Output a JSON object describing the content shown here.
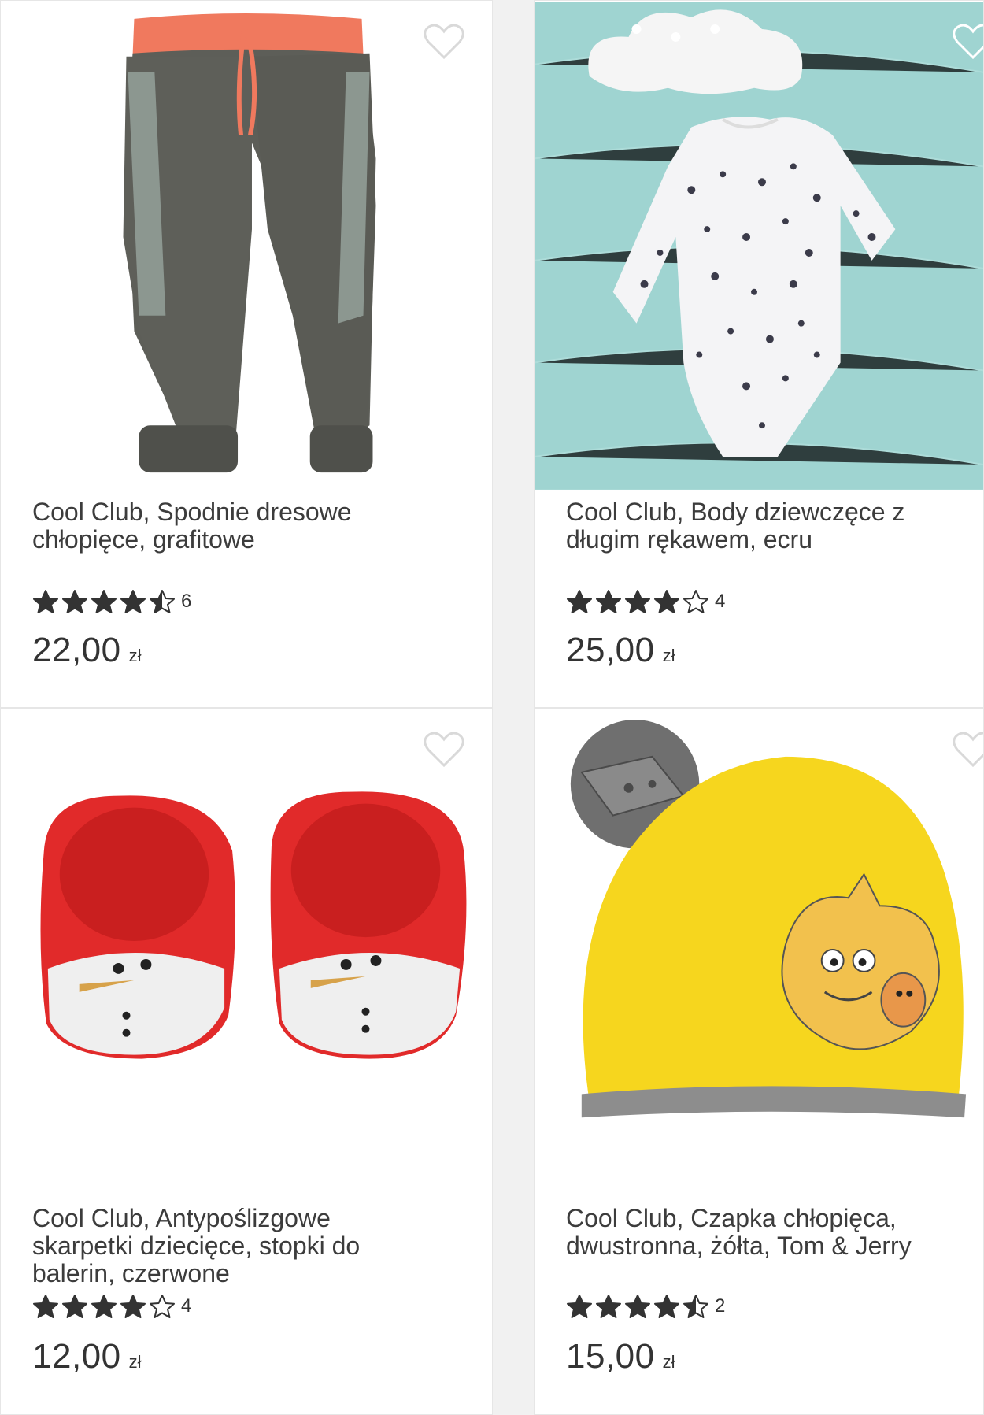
{
  "currency_symbol": "zł",
  "products": [
    {
      "title": "Cool Club, Spodnie dresowe chłopięce, grafitowe",
      "rating": 4.5,
      "review_count": "6",
      "price": "22,00",
      "currency": "zł",
      "image_icon": "graphite-sweatpants-image"
    },
    {
      "title": "Cool Club, Body dziewczęce z długim rękawem, ecru",
      "rating": 4,
      "review_count": "4",
      "price": "25,00",
      "currency": "zł",
      "image_icon": "dotted-bodysuit-image"
    },
    {
      "title": "Cool Club, Antypoślizgowe skarpetki dziecięce, stopki do balerin, czerwone",
      "rating": 4,
      "review_count": "4",
      "price": "12,00",
      "currency": "zł",
      "image_icon": "red-snowman-socks-image"
    },
    {
      "title": "Cool Club, Czapka chłopięca, dwustronna, żółta, Tom & Jerry",
      "rating": 4.5,
      "review_count": "2",
      "price": "15,00",
      "currency": "zł",
      "image_icon": "yellow-tom-jerry-hat-image"
    }
  ],
  "colors": {
    "star": "#333333",
    "wishlist_stroke": "#d9d9d9",
    "card_bg": "#ffffff",
    "page_bg": "#f1f1f1"
  }
}
